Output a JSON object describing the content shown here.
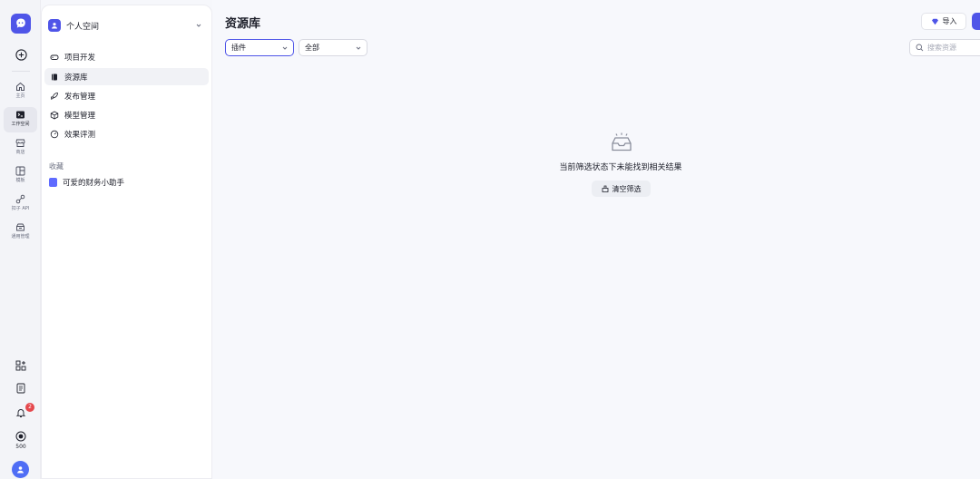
{
  "colors": {
    "accent": "#4f55e8",
    "badge": "#e5484d",
    "muted": "#6b6f80"
  },
  "rail": {
    "items": [
      {
        "label": "主页",
        "icon": "home-icon"
      },
      {
        "label": "工作空间",
        "icon": "terminal-icon",
        "active": true
      },
      {
        "label": "商店",
        "icon": "store-icon"
      },
      {
        "label": "模板",
        "icon": "template-icon"
      },
      {
        "label": "扣子 API",
        "icon": "api-icon"
      },
      {
        "label": "通用管理",
        "icon": "manage-icon"
      }
    ],
    "notifications_badge": "2",
    "points": "500"
  },
  "sidebar": {
    "space_name": "个人空间",
    "nav": [
      {
        "label": "项目开发",
        "icon": "gamepad-icon"
      },
      {
        "label": "资源库",
        "icon": "library-icon",
        "active": true
      },
      {
        "label": "发布管理",
        "icon": "rocket-icon"
      },
      {
        "label": "模型管理",
        "icon": "cube-icon"
      },
      {
        "label": "效果评测",
        "icon": "gauge-icon"
      }
    ],
    "favorites_title": "收藏",
    "favorites": [
      {
        "label": "可爱的财务小助手"
      }
    ]
  },
  "main": {
    "title": "资源库",
    "import_label": "导入",
    "filter_type": "插件",
    "filter_scope": "全部",
    "search_placeholder": "搜索资源",
    "empty_text": "当前筛选状态下未能找到相关结果",
    "clear_label": "清空筛选"
  }
}
